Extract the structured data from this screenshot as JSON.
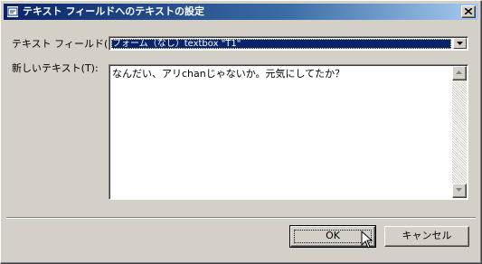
{
  "window": {
    "title": "テキスト フィールドへのテキストの設定"
  },
  "form": {
    "field_label": "テキスト フィールド(F):",
    "field_value": "フォーム（なし）textbox \"T1\"",
    "text_label": "新しいテキスト(T):",
    "text_value": "なんだい、アリchanじゃないか。元気にしてたか？"
  },
  "buttons": {
    "ok": "OK",
    "cancel": "キャンセル"
  },
  "colors": {
    "titlebar_start": "#0a246a",
    "titlebar_end": "#a6caf0",
    "face": "#d4d0c8",
    "selection": "#0a246a"
  }
}
